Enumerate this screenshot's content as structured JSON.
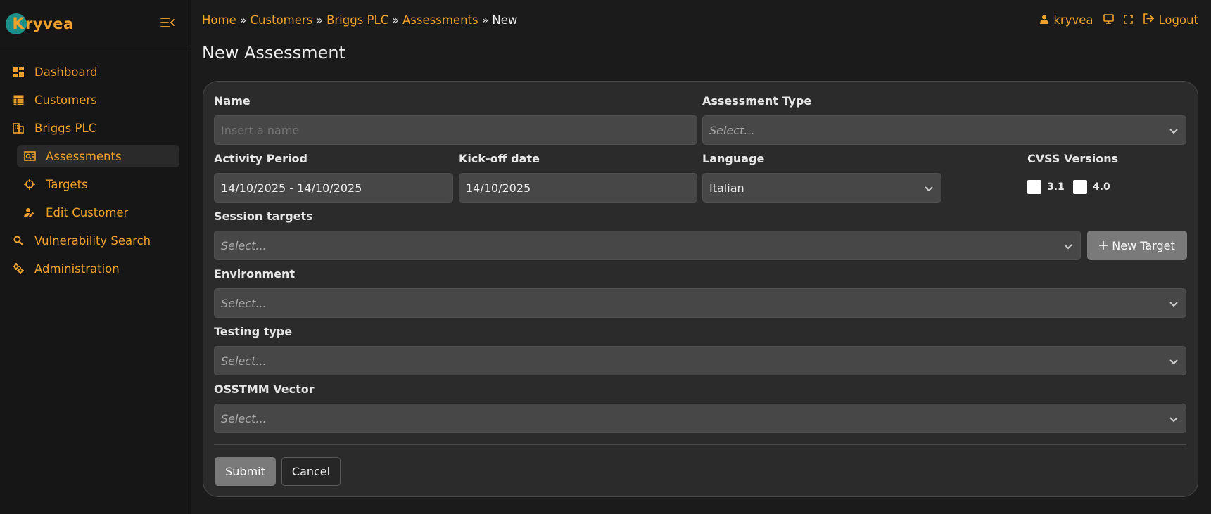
{
  "app": {
    "brand_letter": "K",
    "brand_name": "ryvea"
  },
  "sidebar": {
    "items": [
      {
        "label": "Dashboard",
        "icon": "dashboard-icon"
      },
      {
        "label": "Customers",
        "icon": "table-icon"
      },
      {
        "label": "Briggs PLC",
        "icon": "building-icon"
      },
      {
        "label": "Assessments",
        "icon": "assessment-icon",
        "active": true
      },
      {
        "label": "Targets",
        "icon": "crosshair-icon"
      },
      {
        "label": "Edit Customer",
        "icon": "user-edit-icon"
      },
      {
        "label": "Vulnerability Search",
        "icon": "search-icon"
      },
      {
        "label": "Administration",
        "icon": "gears-icon"
      }
    ]
  },
  "breadcrumb": {
    "items": [
      "Home",
      "Customers",
      "Briggs PLC",
      "Assessments"
    ],
    "separator": "»",
    "current": "New"
  },
  "header": {
    "username": "kryvea",
    "logout_label": "Logout"
  },
  "page": {
    "title": "New Assessment"
  },
  "form": {
    "name": {
      "label": "Name",
      "placeholder": "Insert a name"
    },
    "assessment_type": {
      "label": "Assessment Type",
      "value": "Select..."
    },
    "activity_period": {
      "label": "Activity Period",
      "value": "14/10/2025 - 14/10/2025"
    },
    "kickoff_date": {
      "label": "Kick-off date",
      "value": "14/10/2025"
    },
    "language": {
      "label": "Language",
      "value": "Italian"
    },
    "cvss": {
      "label": "CVSS Versions",
      "v31": "3.1",
      "v40": "4.0"
    },
    "session_targets": {
      "label": "Session targets",
      "value": "Select..."
    },
    "new_target_label": "New Target",
    "environment": {
      "label": "Environment",
      "value": "Select..."
    },
    "testing_type": {
      "label": "Testing type",
      "value": "Select..."
    },
    "osstmm_vector": {
      "label": "OSSTMM Vector",
      "value": "Select..."
    },
    "submit_label": "Submit",
    "cancel_label": "Cancel"
  },
  "colors": {
    "accent": "#f0a12c",
    "background": "#1b1b1b",
    "card": "#2b2b2b",
    "input": "#474747",
    "brand_teal": "#1d8f8a"
  }
}
